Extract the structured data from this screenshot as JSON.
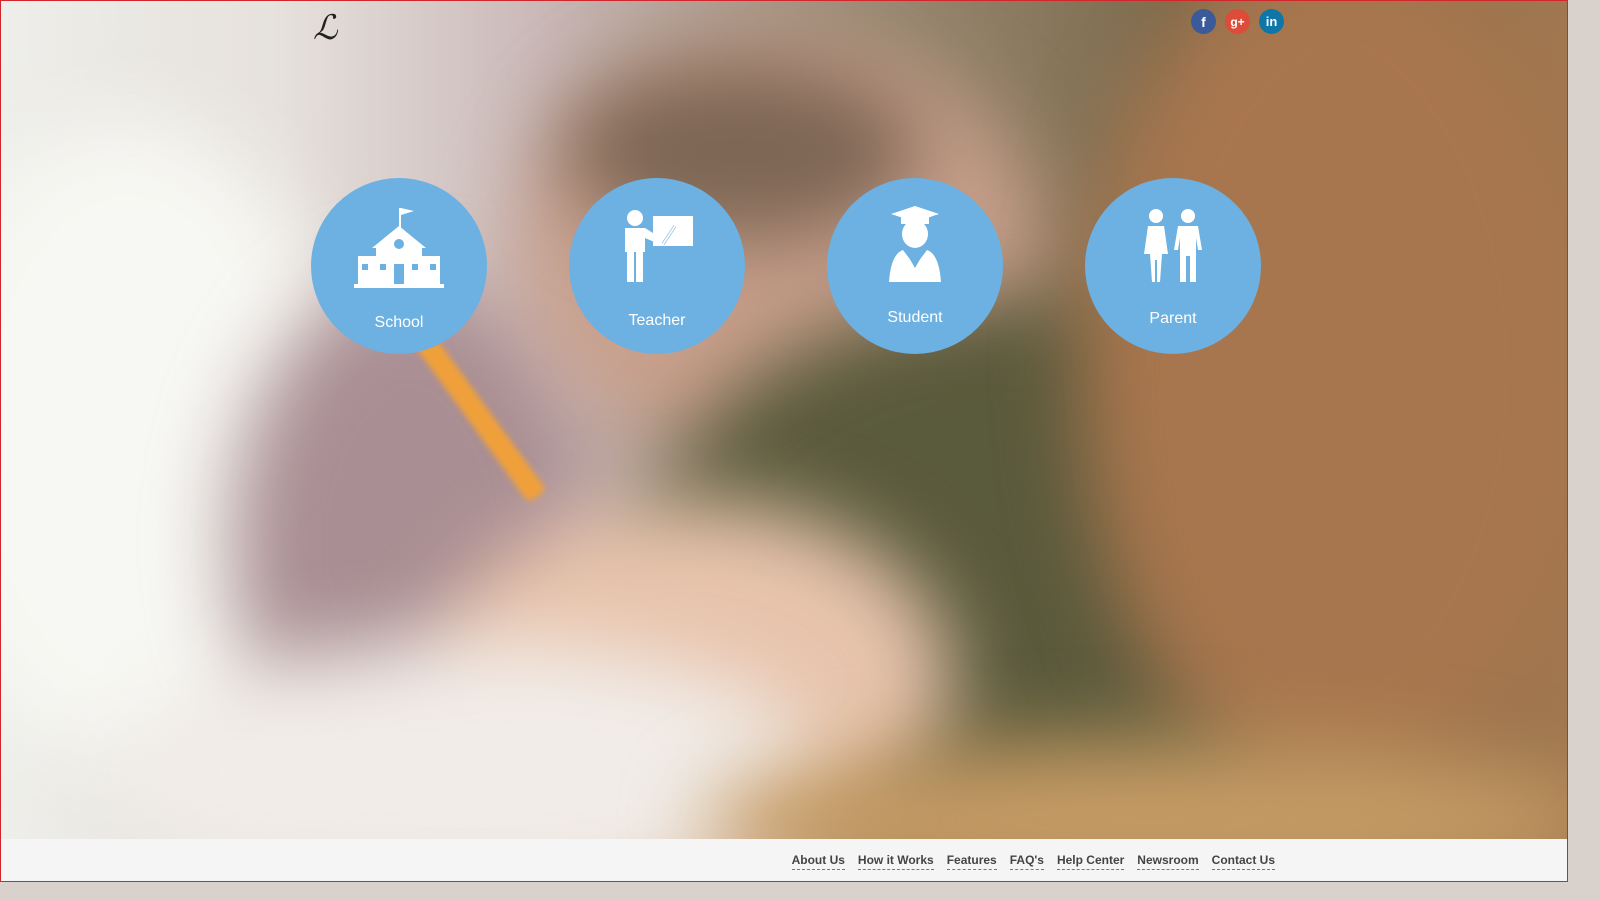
{
  "header": {
    "logo": "ℒ",
    "social": [
      {
        "icon": "facebook-icon",
        "glyph": "f"
      },
      {
        "icon": "google-plus-icon",
        "glyph": "g+"
      },
      {
        "icon": "linkedin-icon",
        "glyph": "in"
      }
    ]
  },
  "roles": [
    {
      "label": "School",
      "icon": "school-building-icon"
    },
    {
      "label": "Teacher",
      "icon": "teacher-board-icon"
    },
    {
      "label": "Student",
      "icon": "graduate-student-icon"
    },
    {
      "label": "Parent",
      "icon": "parents-icon"
    }
  ],
  "footer": {
    "links": [
      "About Us",
      "How it Works",
      "Features",
      "FAQ's",
      "Help Center",
      "Newsroom",
      "Contact Us"
    ]
  },
  "colors": {
    "accent": "#6cb1e1",
    "frame": "#d0262c"
  }
}
